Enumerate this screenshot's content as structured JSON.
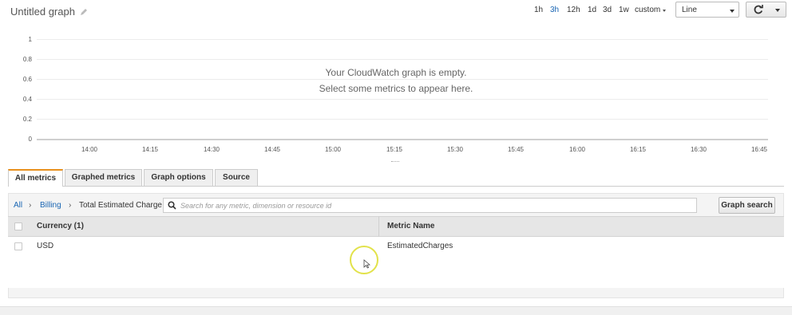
{
  "header": {
    "title": "Untitled graph",
    "ranges": [
      {
        "label": "1h",
        "active": false
      },
      {
        "label": "3h",
        "active": true
      },
      {
        "label": "12h",
        "active": false
      },
      {
        "label": "1d",
        "active": false
      },
      {
        "label": "3d",
        "active": false
      },
      {
        "label": "1w",
        "active": false
      },
      {
        "label": "custom",
        "active": false
      }
    ],
    "graph_type": "Line"
  },
  "graph": {
    "y_ticks": [
      "1",
      "0.8",
      "0.6",
      "0.4",
      "0.2",
      "0"
    ],
    "x_ticks": [
      "14:00",
      "14:15",
      "14:30",
      "14:45",
      "15:00",
      "15:15",
      "15:30",
      "15:45",
      "16:00",
      "16:15",
      "16:30",
      "16:45"
    ],
    "empty_line1": "Your CloudWatch graph is empty.",
    "empty_line2": "Select some metrics to appear here."
  },
  "tabs": [
    {
      "label": "All metrics",
      "active": true
    },
    {
      "label": "Graphed metrics",
      "active": false
    },
    {
      "label": "Graph options",
      "active": false
    },
    {
      "label": "Source",
      "active": false
    }
  ],
  "browser": {
    "breadcrumb": [
      "All",
      "Billing",
      "Total Estimated Charge"
    ],
    "search_placeholder": "Search for any metric, dimension or resource id",
    "graph_search_label": "Graph search",
    "columns": [
      "Currency (1)",
      "Metric Name"
    ],
    "rows": [
      {
        "currency": "USD",
        "metric": "EstimatedCharges"
      }
    ]
  },
  "colors": {
    "accent": "#1a66b3",
    "active_tab": "#e8901d",
    "cursor_highlight": "#e2e24a"
  }
}
